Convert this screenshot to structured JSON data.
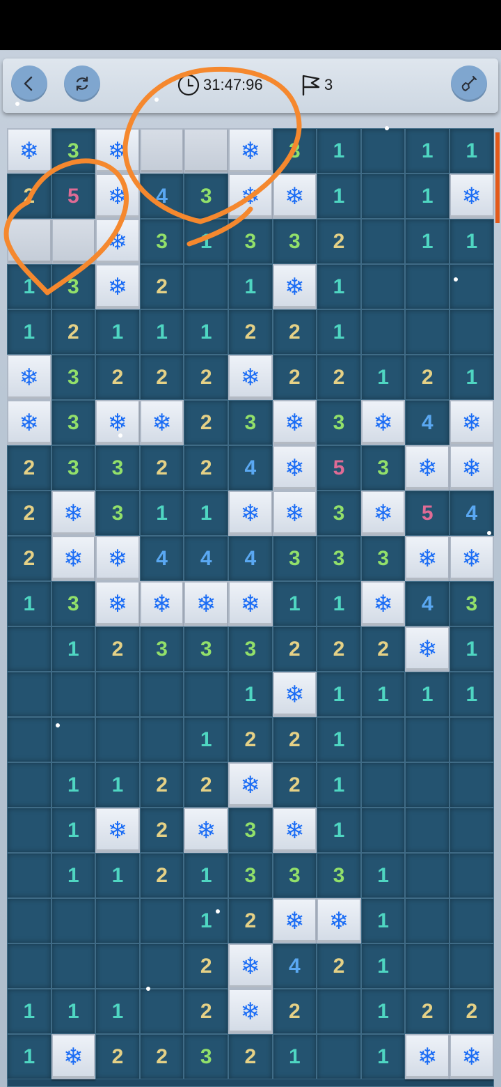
{
  "header": {
    "timer": "31:47:96",
    "flags_remaining": "3",
    "back_icon": "chevron-left-icon",
    "restart_icon": "refresh-icon",
    "timer_icon": "clock-icon",
    "flag_icon": "flag-icon",
    "tool_icon": "shovel-icon"
  },
  "board": {
    "columns": 11,
    "legend": {
      "S": "snowflake mine (raised tile)",
      "U": "unopened tile",
      "0": "empty open tile",
      "1-5": "number on open tile"
    },
    "rows": [
      [
        "S",
        "3",
        "S",
        "U",
        "U",
        "S",
        "3",
        "1",
        "0",
        "1",
        "1"
      ],
      [
        "2",
        "5",
        "S",
        "4",
        "3",
        "S",
        "S",
        "1",
        "0",
        "1",
        "S"
      ],
      [
        "U",
        "U",
        "S",
        "3",
        "1",
        "3",
        "3",
        "2",
        "0",
        "1",
        "1"
      ],
      [
        "1",
        "3",
        "S",
        "2",
        "0",
        "1",
        "S",
        "1",
        "0",
        "0",
        "0"
      ],
      [
        "1",
        "2",
        "1",
        "1",
        "1",
        "2",
        "2",
        "1",
        "0",
        "0",
        "0"
      ],
      [
        "S",
        "3",
        "2",
        "2",
        "2",
        "S",
        "2",
        "2",
        "1",
        "2",
        "1"
      ],
      [
        "S",
        "3",
        "S",
        "S",
        "2",
        "3",
        "S",
        "3",
        "S",
        "4",
        "S"
      ],
      [
        "2",
        "3",
        "3",
        "2",
        "2",
        "4",
        "S",
        "5",
        "3",
        "S",
        "S"
      ],
      [
        "2",
        "S",
        "3",
        "1",
        "1",
        "S",
        "S",
        "3",
        "S",
        "5",
        "4"
      ],
      [
        "2",
        "S",
        "S",
        "4",
        "4",
        "4",
        "3",
        "3",
        "3",
        "S",
        "S"
      ],
      [
        "1",
        "3",
        "S",
        "S",
        "S",
        "S",
        "1",
        "1",
        "S",
        "4",
        "3"
      ],
      [
        "0",
        "1",
        "2",
        "3",
        "3",
        "3",
        "2",
        "2",
        "2",
        "S",
        "1"
      ],
      [
        "0",
        "0",
        "0",
        "0",
        "0",
        "1",
        "S",
        "1",
        "1",
        "1",
        "1"
      ],
      [
        "0",
        "0",
        "0",
        "0",
        "1",
        "2",
        "2",
        "1",
        "0",
        "0",
        "0"
      ],
      [
        "0",
        "1",
        "1",
        "2",
        "2",
        "S",
        "2",
        "1",
        "0",
        "0",
        "0"
      ],
      [
        "0",
        "1",
        "S",
        "2",
        "S",
        "3",
        "S",
        "1",
        "0",
        "0",
        "0"
      ],
      [
        "0",
        "1",
        "1",
        "2",
        "1",
        "3",
        "3",
        "3",
        "1",
        "0",
        "0"
      ],
      [
        "0",
        "0",
        "0",
        "0",
        "1",
        "2",
        "S",
        "S",
        "1",
        "0",
        "0"
      ],
      [
        "0",
        "0",
        "0",
        "0",
        "2",
        "S",
        "4",
        "2",
        "1",
        "0",
        "0"
      ],
      [
        "1",
        "1",
        "1",
        "0",
        "2",
        "S",
        "2",
        "0",
        "1",
        "2",
        "2"
      ],
      [
        "1",
        "S",
        "2",
        "2",
        "3",
        "2",
        "1",
        "0",
        "1",
        "S",
        "S"
      ]
    ]
  },
  "colors": {
    "board_bg": "#1f4863",
    "accent_scroll": "#e35a1a",
    "annotation_stroke": "#f5882e",
    "mine": "#1a6cf5",
    "n1": "#4fd6c2",
    "n2": "#e5d186",
    "n3": "#92e06a",
    "n4": "#5aa8f2",
    "n5": "#e06b95"
  }
}
